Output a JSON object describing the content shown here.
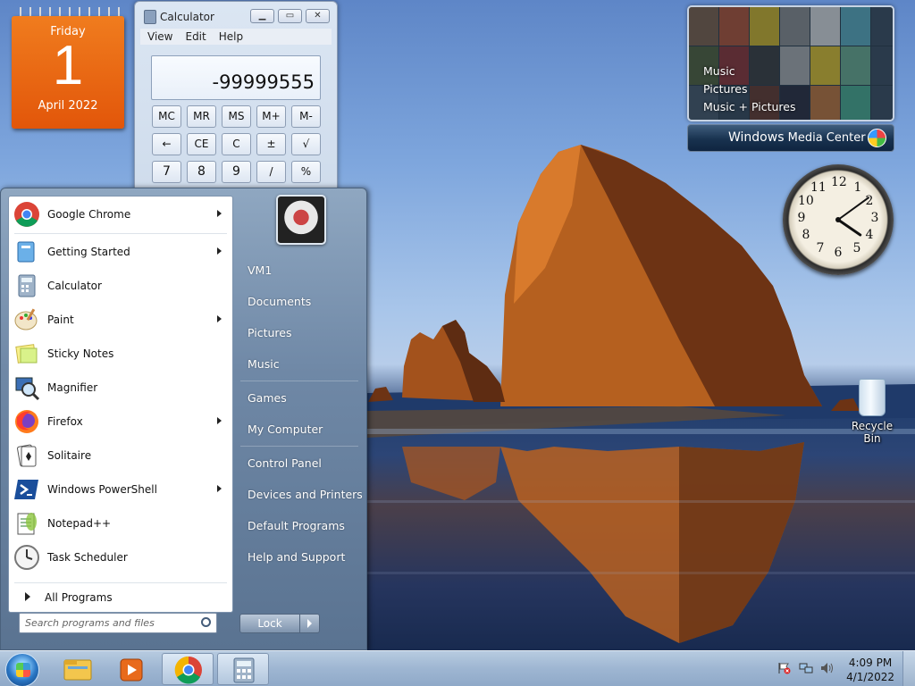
{
  "calendar": {
    "weekday": "Friday",
    "day": "1",
    "month_year": "April 2022"
  },
  "calculator": {
    "title": "Calculator",
    "menu": [
      "View",
      "Edit",
      "Help"
    ],
    "display": "-99999555",
    "keys": [
      "MC",
      "MR",
      "MS",
      "M+",
      "M-",
      "←",
      "CE",
      "C",
      "±",
      "√",
      "7",
      "8",
      "9",
      "/",
      "%"
    ]
  },
  "media_center": {
    "items": [
      "Music",
      "Pictures",
      "Music + Pictures"
    ],
    "bar_title_strong": "Windows",
    "bar_title_rest": " Media Center"
  },
  "clock": {
    "numbers": [
      "12",
      "1",
      "2",
      "3",
      "4",
      "5",
      "6",
      "7",
      "8",
      "9",
      "10",
      "11"
    ],
    "hour": 4,
    "minute": 9
  },
  "desktop": {
    "recycle_bin": "Recycle Bin"
  },
  "start_menu": {
    "programs": [
      {
        "label": "Google Chrome",
        "icon": "chrome-icon",
        "submenu": true
      },
      {
        "label": "Getting Started",
        "icon": "getting-started-icon",
        "submenu": true
      },
      {
        "label": "Calculator",
        "icon": "calculator-icon",
        "submenu": false
      },
      {
        "label": "Paint",
        "icon": "paint-icon",
        "submenu": true
      },
      {
        "label": "Sticky Notes",
        "icon": "sticky-notes-icon",
        "submenu": false
      },
      {
        "label": "Magnifier",
        "icon": "magnifier-icon",
        "submenu": false
      },
      {
        "label": "Firefox",
        "icon": "firefox-icon",
        "submenu": true
      },
      {
        "label": "Solitaire",
        "icon": "solitaire-icon",
        "submenu": false
      },
      {
        "label": "Windows PowerShell",
        "icon": "powershell-icon",
        "submenu": true
      },
      {
        "label": "Notepad++",
        "icon": "notepadpp-icon",
        "submenu": false
      },
      {
        "label": "Task Scheduler",
        "icon": "task-scheduler-icon",
        "submenu": false
      }
    ],
    "all_programs": "All Programs",
    "search_placeholder": "Search programs and files",
    "right_links": [
      "VM1",
      "Documents",
      "Pictures",
      "Music",
      "Games",
      "My Computer",
      "Control Panel",
      "Devices and Printers",
      "Default Programs",
      "Help and Support"
    ],
    "lock_label": "Lock"
  },
  "taskbar": {
    "items": [
      "file-explorer-icon",
      "media-player-icon",
      "chrome-icon",
      "calculator-icon"
    ],
    "time": "4:09 PM",
    "date": "4/1/2022"
  },
  "colors": {
    "calendar_orange": "#e2560a",
    "start_menu_blue": "#6f88a6",
    "taskbar": "#9eb6d2"
  }
}
